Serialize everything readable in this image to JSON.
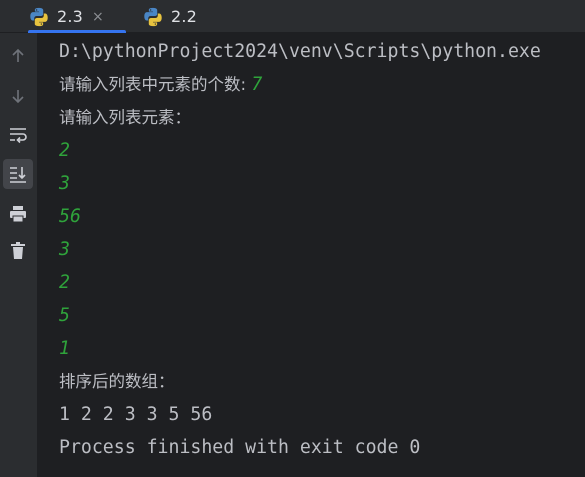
{
  "tabs": [
    {
      "label": "2.3",
      "active": true,
      "icon": "python-icon"
    },
    {
      "label": "2.2",
      "active": false,
      "icon": "python-icon"
    }
  ],
  "tab_close_glyph": "×",
  "toolbar": [
    {
      "name": "scroll-up-icon",
      "selected": false
    },
    {
      "name": "scroll-down-icon",
      "selected": false
    },
    {
      "name": "soft-wrap-icon",
      "selected": false
    },
    {
      "name": "scroll-to-end-icon",
      "selected": true
    },
    {
      "name": "print-icon",
      "selected": false
    },
    {
      "name": "trash-icon",
      "selected": false
    }
  ],
  "console": {
    "command": "D:\\pythonProject2024\\venv\\Scripts\\python.exe",
    "prompt_count": "请输入列表中元素的个数: ",
    "count_value": "7",
    "prompt_elements": "请输入列表元素：",
    "inputs": [
      "2",
      "3",
      "56",
      "3",
      "2",
      "5",
      "1"
    ],
    "sorted_label": "排序后的数组：",
    "sorted_result": "1 2 2 3 3 5 56",
    "exit_message": "Process finished with exit code 0"
  },
  "colors": {
    "background": "#1e1f22",
    "panel": "#2b2d30",
    "text": "#bcbec4",
    "user_input": "#2fa33b",
    "accent": "#3574f0"
  }
}
